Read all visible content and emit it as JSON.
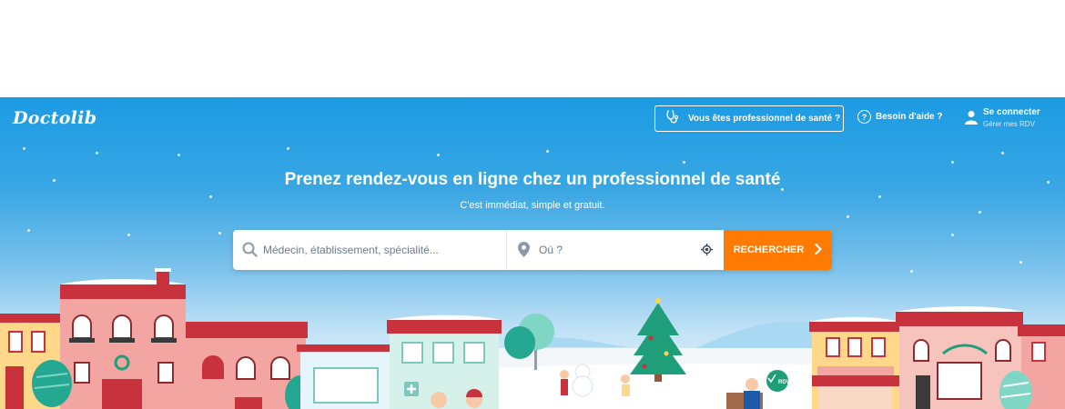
{
  "header": {
    "logo": "Doctolib",
    "pro_button": "Vous êtes professionnel de santé ?",
    "help_link": "Besoin d'aide ?",
    "login_title": "Se connecter",
    "login_subtitle": "Gérer mes RDV"
  },
  "hero": {
    "title": "Prenez rendez-vous en ligne chez un professionnel de santé",
    "subtitle": "C'est immédiat, simple et gratuit."
  },
  "search": {
    "query_placeholder": "Médecin, établissement, spécialité...",
    "location_placeholder": "Où ?",
    "button_label": "RECHERCHER"
  },
  "illustration": {
    "badge": "RDV"
  },
  "colors": {
    "brand_blue": "#1b9be3",
    "search_button": "#ff7a00",
    "roof_red": "#c8323c",
    "tree_green": "#1f9e7a"
  },
  "icons": [
    "stethoscope-icon",
    "help-icon",
    "user-icon",
    "search-icon",
    "location-pin-icon",
    "geolocate-icon",
    "chevron-right-icon",
    "check-icon"
  ]
}
